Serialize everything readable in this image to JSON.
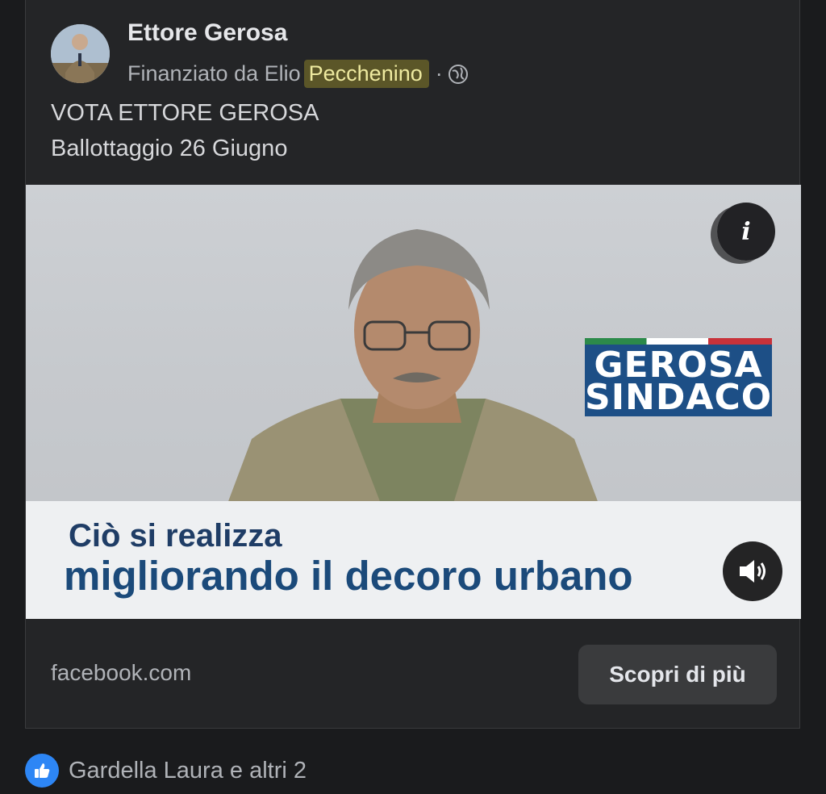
{
  "post": {
    "page_name": "Ettore Gerosa",
    "sponsor_prefix": "Finanziato da Elio",
    "sponsor_highlight": "Pecchenino",
    "sponsor_separator": "·",
    "caption_line1": "VOTA ETTORE GEROSA",
    "caption_line2": "Ballottaggio 26 Giugno"
  },
  "video": {
    "logo_line1": "GEROSA",
    "logo_line2": "SINDACO",
    "subtitle_line1": "Ciò si realizza",
    "subtitle_line2": "migliorando il decoro urbano",
    "info_glyph": "i"
  },
  "footer": {
    "domain": "facebook.com",
    "cta_label": "Scopri di più"
  },
  "reactions": {
    "text": "Gardella Laura e altri 2"
  },
  "icons": {
    "globe": "globe-icon",
    "info": "info-icon",
    "sound": "speaker-icon",
    "like": "thumbs-up-icon"
  },
  "colors": {
    "background": "#1a1b1d",
    "card": "#242527",
    "highlight": "#5b5628",
    "logo_blue": "#1d4f86",
    "subtitle_blue": "#1b4a7a",
    "like_blue": "#2d86f5"
  }
}
